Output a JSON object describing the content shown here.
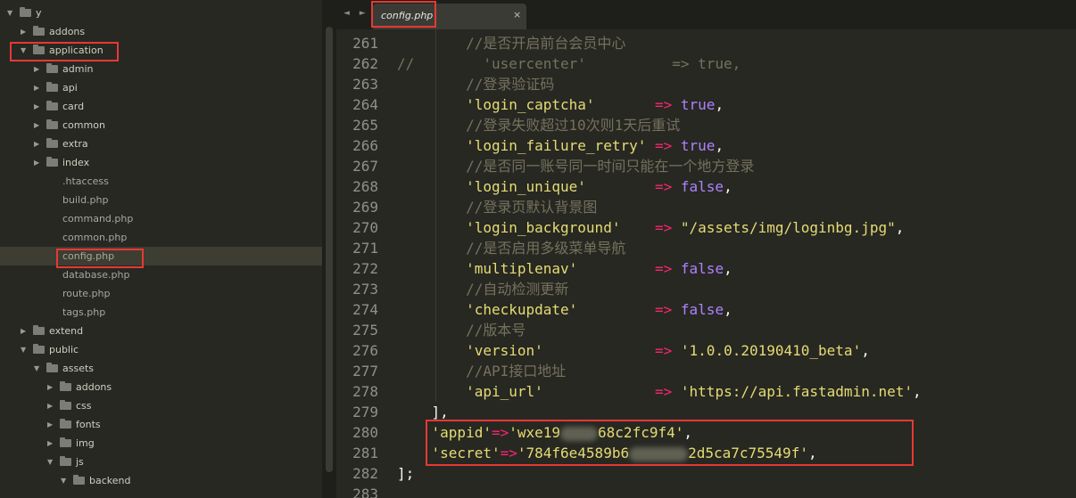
{
  "tab": {
    "label": "config.php",
    "close_glyph": "×"
  },
  "tree": [
    {
      "label": "y",
      "depth": 0,
      "expanded": true,
      "type": "folder"
    },
    {
      "label": "addons",
      "depth": 1,
      "expanded": false,
      "type": "folder"
    },
    {
      "label": "application",
      "depth": 1,
      "expanded": true,
      "type": "folder"
    },
    {
      "label": "admin",
      "depth": 2,
      "expanded": false,
      "type": "folder"
    },
    {
      "label": "api",
      "depth": 2,
      "expanded": false,
      "type": "folder"
    },
    {
      "label": "card",
      "depth": 2,
      "expanded": false,
      "type": "folder"
    },
    {
      "label": "common",
      "depth": 2,
      "expanded": false,
      "type": "folder"
    },
    {
      "label": "extra",
      "depth": 2,
      "expanded": false,
      "type": "folder"
    },
    {
      "label": "index",
      "depth": 2,
      "expanded": false,
      "type": "folder"
    },
    {
      "label": ".htaccess",
      "depth": 2,
      "type": "file"
    },
    {
      "label": "build.php",
      "depth": 2,
      "type": "file"
    },
    {
      "label": "command.php",
      "depth": 2,
      "type": "file"
    },
    {
      "label": "common.php",
      "depth": 2,
      "type": "file"
    },
    {
      "label": "config.php",
      "depth": 2,
      "type": "file",
      "selected": true
    },
    {
      "label": "database.php",
      "depth": 2,
      "type": "file"
    },
    {
      "label": "route.php",
      "depth": 2,
      "type": "file"
    },
    {
      "label": "tags.php",
      "depth": 2,
      "type": "file"
    },
    {
      "label": "extend",
      "depth": 1,
      "expanded": false,
      "type": "folder"
    },
    {
      "label": "public",
      "depth": 1,
      "expanded": true,
      "type": "folder"
    },
    {
      "label": "assets",
      "depth": 2,
      "expanded": true,
      "type": "folder"
    },
    {
      "label": "addons",
      "depth": 3,
      "expanded": false,
      "type": "folder"
    },
    {
      "label": "css",
      "depth": 3,
      "expanded": false,
      "type": "folder"
    },
    {
      "label": "fonts",
      "depth": 3,
      "expanded": false,
      "type": "folder"
    },
    {
      "label": "img",
      "depth": 3,
      "expanded": false,
      "type": "folder"
    },
    {
      "label": "js",
      "depth": 3,
      "expanded": true,
      "type": "folder"
    },
    {
      "label": "backend",
      "depth": 4,
      "expanded": true,
      "type": "folder"
    }
  ],
  "code_lines": [
    {
      "n": "261",
      "tokens": [
        [
          "c",
          "        //是否开启前台会员中心"
        ]
      ]
    },
    {
      "n": "262",
      "tokens": [
        [
          "c",
          "//        'usercenter'          => true,"
        ]
      ],
      "no_indent": true
    },
    {
      "n": "263",
      "tokens": [
        [
          "c",
          "        //登录验证码"
        ]
      ]
    },
    {
      "n": "264",
      "tokens": [
        [
          "s",
          "        'login_captcha'"
        ],
        [
          "p",
          "       "
        ],
        [
          "o",
          "=>"
        ],
        [
          "p",
          " "
        ],
        [
          "k",
          "true"
        ],
        [
          "p",
          ","
        ]
      ]
    },
    {
      "n": "265",
      "tokens": [
        [
          "c",
          "        //登录失败超过10次则1天后重试"
        ]
      ]
    },
    {
      "n": "266",
      "tokens": [
        [
          "s",
          "        'login_failure_retry'"
        ],
        [
          "p",
          " "
        ],
        [
          "o",
          "=>"
        ],
        [
          "p",
          " "
        ],
        [
          "k",
          "true"
        ],
        [
          "p",
          ","
        ]
      ]
    },
    {
      "n": "267",
      "tokens": [
        [
          "c",
          "        //是否同一账号同一时间只能在一个地方登录"
        ]
      ]
    },
    {
      "n": "268",
      "tokens": [
        [
          "s",
          "        'login_unique'"
        ],
        [
          "p",
          "        "
        ],
        [
          "o",
          "=>"
        ],
        [
          "p",
          " "
        ],
        [
          "k",
          "false"
        ],
        [
          "p",
          ","
        ]
      ]
    },
    {
      "n": "269",
      "tokens": [
        [
          "c",
          "        //登录页默认背景图"
        ]
      ]
    },
    {
      "n": "270",
      "tokens": [
        [
          "s",
          "        'login_background'"
        ],
        [
          "p",
          "    "
        ],
        [
          "o",
          "=>"
        ],
        [
          "p",
          " "
        ],
        [
          "s",
          "\"/assets/img/loginbg.jpg\""
        ],
        [
          "p",
          ","
        ]
      ]
    },
    {
      "n": "271",
      "tokens": [
        [
          "c",
          "        //是否启用多级菜单导航"
        ]
      ]
    },
    {
      "n": "272",
      "tokens": [
        [
          "s",
          "        'multiplenav'"
        ],
        [
          "p",
          "         "
        ],
        [
          "o",
          "=>"
        ],
        [
          "p",
          " "
        ],
        [
          "k",
          "false"
        ],
        [
          "p",
          ","
        ]
      ]
    },
    {
      "n": "273",
      "tokens": [
        [
          "c",
          "        //自动检测更新"
        ]
      ]
    },
    {
      "n": "274",
      "tokens": [
        [
          "s",
          "        'checkupdate'"
        ],
        [
          "p",
          "         "
        ],
        [
          "o",
          "=>"
        ],
        [
          "p",
          " "
        ],
        [
          "k",
          "false"
        ],
        [
          "p",
          ","
        ]
      ]
    },
    {
      "n": "275",
      "tokens": [
        [
          "c",
          "        //版本号"
        ]
      ]
    },
    {
      "n": "276",
      "tokens": [
        [
          "s",
          "        'version'"
        ],
        [
          "p",
          "             "
        ],
        [
          "o",
          "=>"
        ],
        [
          "p",
          " "
        ],
        [
          "s",
          "'1.0.0.20190410_beta'"
        ],
        [
          "p",
          ","
        ]
      ]
    },
    {
      "n": "277",
      "tokens": [
        [
          "c",
          "        //API接口地址"
        ]
      ]
    },
    {
      "n": "278",
      "tokens": [
        [
          "s",
          "        'api_url'"
        ],
        [
          "p",
          "             "
        ],
        [
          "o",
          "=>"
        ],
        [
          "p",
          " "
        ],
        [
          "s",
          "'https://api.fastadmin.net'"
        ],
        [
          "p",
          ","
        ]
      ]
    },
    {
      "n": "279",
      "tokens": [
        [
          "p",
          "    ],"
        ]
      ]
    },
    {
      "n": "280",
      "tokens": [
        [
          "s",
          "    'appid'"
        ],
        [
          "o",
          "=>"
        ],
        [
          "s",
          "'wxe19"
        ],
        [
          "blur",
          ""
        ],
        [
          "s",
          "68c2fc9f4'"
        ],
        [
          "p",
          ","
        ]
      ]
    },
    {
      "n": "281",
      "tokens": [
        [
          "s",
          "    'secret'"
        ],
        [
          "o",
          "=>"
        ],
        [
          "s",
          "'784f6e4589b6"
        ],
        [
          "blurwide",
          ""
        ],
        [
          "s",
          "2d5ca7c75549f'"
        ],
        [
          "p",
          ","
        ]
      ]
    },
    {
      "n": "282",
      "tokens": [
        [
          "p",
          "];"
        ]
      ]
    },
    {
      "n": "283",
      "tokens": []
    }
  ]
}
